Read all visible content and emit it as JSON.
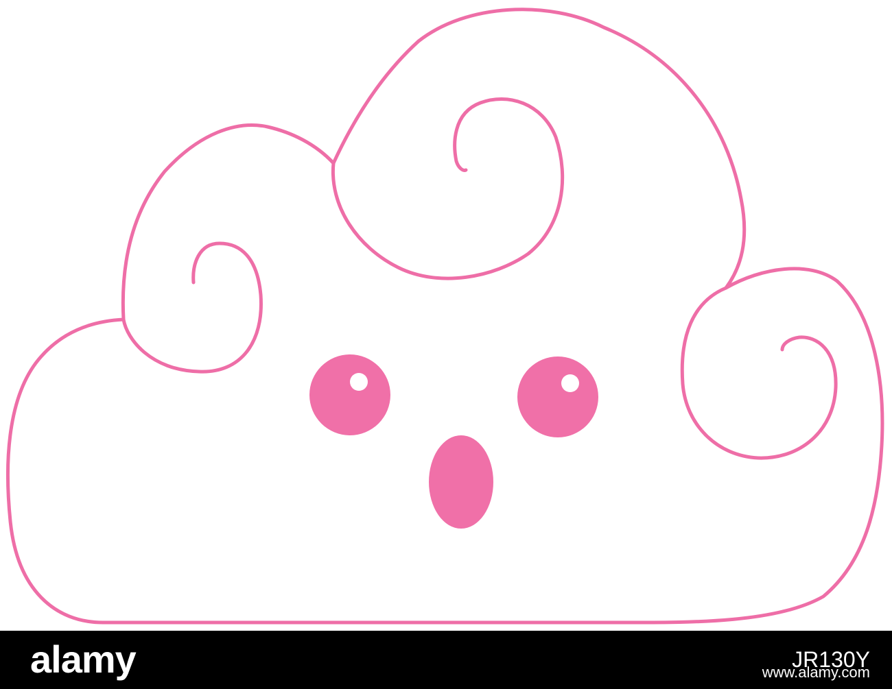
{
  "colors": {
    "outline": "#ee6ea7",
    "fill": "#f070a8",
    "background": "#ffffff",
    "footer_background": "#000000",
    "footer_text": "#ffffff"
  },
  "illustration": {
    "subject": "cloud-character",
    "expression": "surprised"
  },
  "footer": {
    "brand": "alamy",
    "image_id": "JR130Y",
    "url": "www.alamy.com"
  }
}
